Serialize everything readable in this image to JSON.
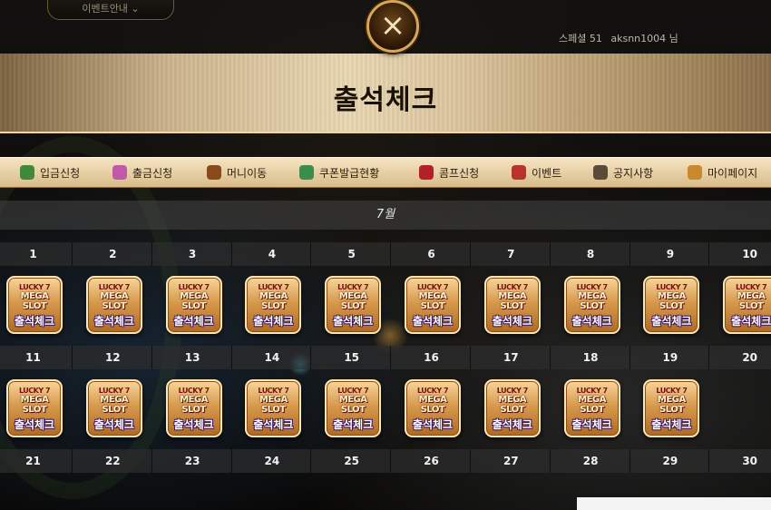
{
  "top": {
    "event_button": "이벤트안내",
    "user_level": "스페셜 51",
    "user_id": "aksnn1004",
    "user_suffix": "님"
  },
  "close_icon": "×",
  "page_title": "출석체크",
  "menu": [
    {
      "label": "입금신청",
      "icon": "money-bag-icon",
      "color": "#3f8a3a"
    },
    {
      "label": "출금신청",
      "icon": "coin-icon",
      "color": "#c05aa8"
    },
    {
      "label": "머니이동",
      "icon": "chest-icon",
      "color": "#8a4b1c"
    },
    {
      "label": "쿠폰발급현황",
      "icon": "flower-icon",
      "color": "#3c8c4a"
    },
    {
      "label": "콤프신청",
      "icon": "cherry-icon",
      "color": "#b3202a"
    },
    {
      "label": "이벤트",
      "icon": "star-icon",
      "color": "#b8332a"
    },
    {
      "label": "공지사항",
      "icon": "book-icon",
      "color": "#5a4a3a"
    },
    {
      "label": "마이페이지",
      "icon": "crown-icon",
      "color": "#c9892e"
    }
  ],
  "calendar": {
    "month": "7월",
    "rows": [
      {
        "days": [
          "1",
          "2",
          "3",
          "4",
          "5",
          "6",
          "7",
          "8",
          "9",
          "10"
        ]
      },
      {
        "days": [
          "11",
          "12",
          "13",
          "14",
          "15",
          "16",
          "17",
          "18",
          "19",
          "20"
        ]
      },
      {
        "days": [
          "21",
          "22",
          "23",
          "24",
          "25",
          "26",
          "27",
          "28",
          "29",
          "30"
        ]
      }
    ],
    "stamp_rows": [
      10,
      9
    ],
    "stamp": {
      "badge": "LUCKY 7",
      "brand": "MEGA SLOT",
      "label": "출석체크"
    }
  }
}
